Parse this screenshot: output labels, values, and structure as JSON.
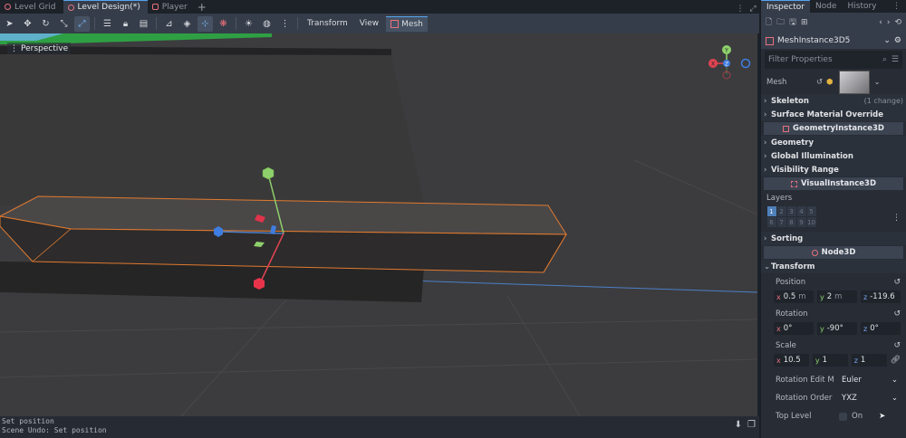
{
  "scene_tabs": [
    {
      "label": "Level Grid",
      "active": false
    },
    {
      "label": "Level Design(*)",
      "active": true
    },
    {
      "label": "Player",
      "active": false
    }
  ],
  "toolbar": {
    "menus": [
      "Transform",
      "View"
    ],
    "mesh_menu": "Mesh"
  },
  "viewport": {
    "camera_label": "Perspective",
    "gizmo_labels": {
      "x": "X",
      "y": "Y",
      "z": "Z"
    }
  },
  "output": {
    "lines": [
      "Set position",
      "Scene Undo: Set position"
    ]
  },
  "inspector": {
    "tabs": [
      {
        "label": "Inspector",
        "active": true
      },
      {
        "label": "Node",
        "active": false
      },
      {
        "label": "History",
        "active": false
      }
    ],
    "node_name": "MeshInstance3D5",
    "filter_placeholder": "Filter Properties",
    "mesh_label": "Mesh",
    "sections": {
      "skeleton": "Skeleton",
      "skeleton_note": "(1 change)",
      "surface_material": "Surface Material Override",
      "geometry_instance": "GeometryInstance3D",
      "geometry": "Geometry",
      "global_illumination": "Global Illumination",
      "visibility_range": "Visibility Range",
      "visual_instance": "VisualInstance3D",
      "layers": "Layers",
      "sorting": "Sorting",
      "node3d": "Node3D",
      "transform": "Transform"
    },
    "layers_row1": [
      "1",
      "2",
      "3",
      "4",
      "5"
    ],
    "layers_row2": [
      "6",
      "7",
      "8",
      "9",
      "10"
    ],
    "position": {
      "label": "Position",
      "x": "0.5",
      "y": "2",
      "z": "-119.6",
      "unit": "m"
    },
    "rotation": {
      "label": "Rotation",
      "x": "0°",
      "y": "-90°",
      "z": "0°"
    },
    "scale": {
      "label": "Scale",
      "x": "10.5",
      "y": "1",
      "z": "1"
    },
    "rotation_edit_mode": {
      "label": "Rotation Edit M",
      "value": "Euler"
    },
    "rotation_order": {
      "label": "Rotation Order",
      "value": "YXZ"
    },
    "top_level": {
      "label": "Top Level",
      "value": "On"
    }
  },
  "colors": {
    "accent": "#56a3f0",
    "axis_x": "#e9717c",
    "axis_y": "#8ed06b",
    "axis_z": "#77a5ee",
    "selection_outline": "#e07a2f"
  }
}
